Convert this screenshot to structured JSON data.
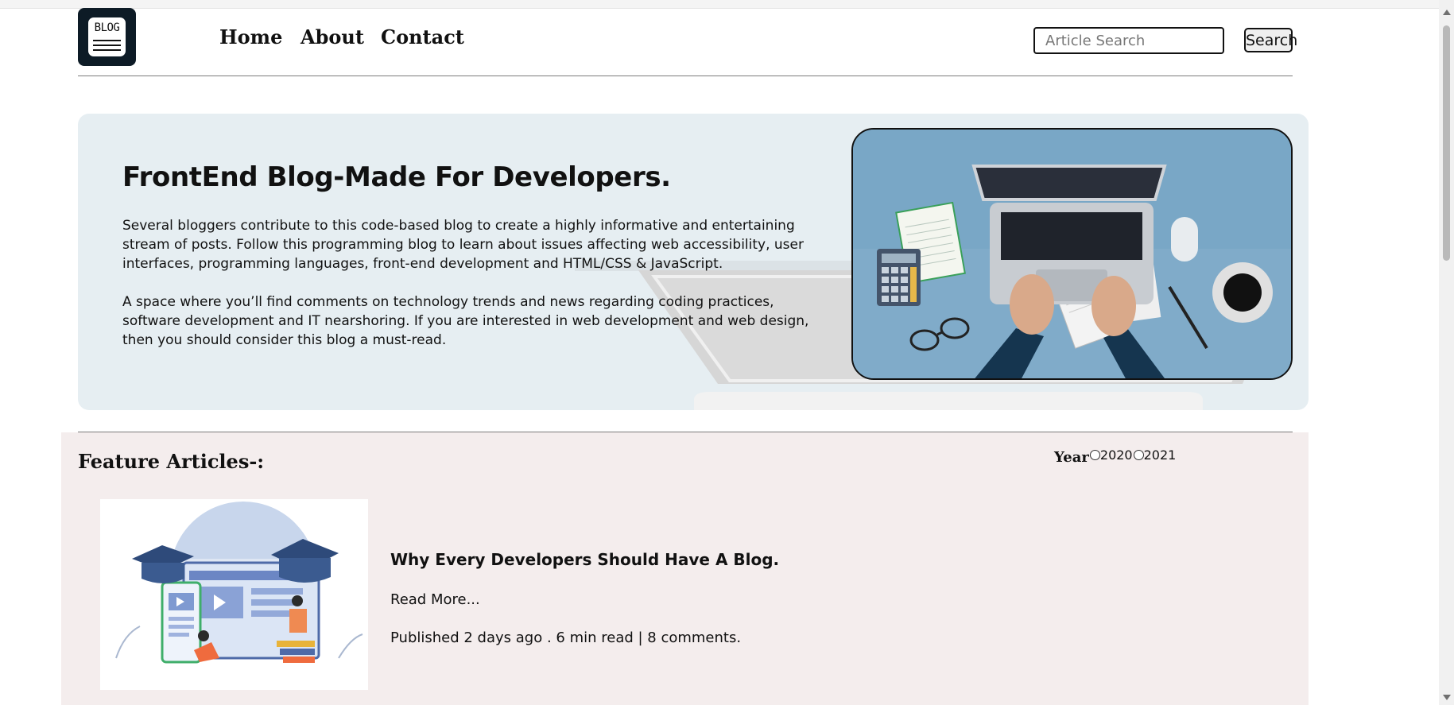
{
  "header": {
    "logo_text": "BLOG",
    "nav": [
      "Home",
      "About",
      "Contact"
    ],
    "search": {
      "placeholder": "Article Search",
      "value": "",
      "button_label": "Search"
    }
  },
  "hero": {
    "title": "FrontEnd Blog-Made For Developers.",
    "paragraph_1": "Several bloggers contribute to this code-based blog to create a highly informative and entertaining stream of posts. Follow this programming blog to learn about issues affecting web accessibility, user interfaces, programming languages, front-end development and HTML/CSS & JavaScript.",
    "paragraph_2": "A space where you’ll find comments on technology trends and news regarding coding practices, software development and IT nearshoring. If you are interested in web development and web design, then you should consider this blog a must-read.",
    "image_icon": "laptop-desk-illustration-icon"
  },
  "featured": {
    "title": "Feature Articles-:",
    "year_filter": {
      "label": "Year",
      "options": [
        "2020",
        "2021"
      ],
      "selected": ""
    },
    "articles": [
      {
        "title": "Why Every Developers Should Have A Blog.",
        "read_more": "Read More...",
        "meta": "Published 2 days ago . 6 min read | 8 comments.",
        "image_icon": "online-education-illustration-icon"
      }
    ]
  },
  "colors": {
    "hero_bg": "#e6eef2",
    "featured_bg": "#f4eded",
    "hero_image_bg": "#79a7c6",
    "logo_bg": "#0d1b26"
  }
}
